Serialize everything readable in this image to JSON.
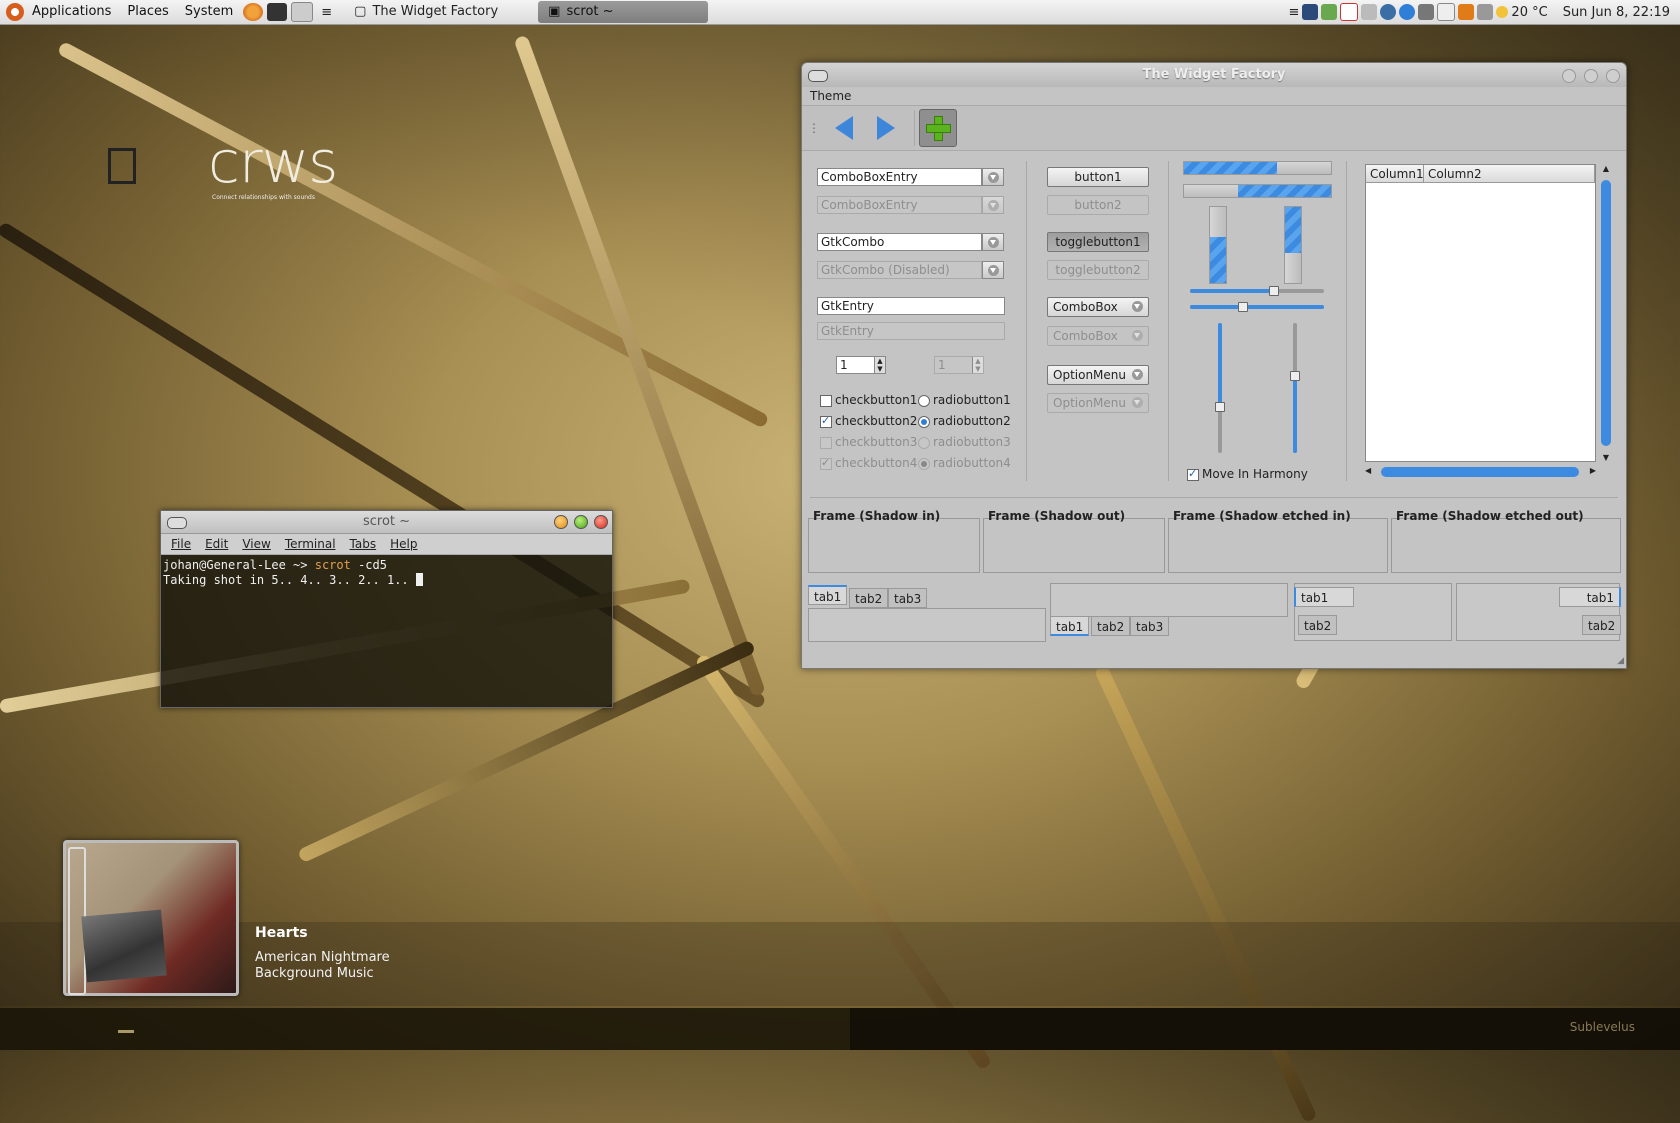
{
  "top_panel": {
    "menus": [
      "Applications",
      "Places",
      "System"
    ],
    "tasks": [
      {
        "label": "The Widget Factory"
      },
      {
        "label": "scrot  ~"
      }
    ],
    "weather": "20 °C",
    "clock": "Sun Jun  8, 22:19"
  },
  "desktop": {
    "logo_text": "crws",
    "logo_tagline": "Connect relationships with sounds"
  },
  "widget_factory": {
    "title": "The Widget Factory",
    "menu_label": "Theme",
    "entries": {
      "combo_entry_1": "ComboBoxEntry",
      "combo_entry_2": "ComboBoxEntry",
      "gtk_combo": "GtkCombo",
      "gtk_combo_disabled": "GtkCombo (Disabled)",
      "gtk_entry": "GtkEntry",
      "gtk_entry_disabled": "GtkEntry"
    },
    "spin_values": [
      "1",
      "1"
    ],
    "checks": [
      "checkbutton1",
      "checkbutton2",
      "checkbutton3",
      "checkbutton4"
    ],
    "radios": [
      "radiobutton1",
      "radiobutton2",
      "radiobutton3",
      "radiobutton4"
    ],
    "buttons": {
      "button1": "button1",
      "button2": "button2",
      "toggle1": "togglebutton1",
      "toggle2": "togglebutton2",
      "combobox1": "ComboBox",
      "combobox2": "ComboBox",
      "optionmenu1": "OptionMenu",
      "optionmenu2": "OptionMenu"
    },
    "progress": {
      "h1": 0.63,
      "h2": 0.63,
      "v1": 0.6,
      "v2": 0.6
    },
    "sliders": {
      "h1": 0.6,
      "h2": 0.36,
      "v1": 0.62,
      "v2": 0.38
    },
    "move_in_harmony": "Move In Harmony",
    "columns": [
      "Column1",
      "Column2"
    ],
    "frames": [
      "Frame (Shadow in)",
      "Frame (Shadow out)",
      "Frame (Shadow etched in)",
      "Frame (Shadow etched out)"
    ],
    "tabs": [
      "tab1",
      "tab2",
      "tab3"
    ]
  },
  "terminal": {
    "title": "scrot  ~",
    "menus": [
      "File",
      "Edit",
      "View",
      "Terminal",
      "Tabs",
      "Help"
    ],
    "prompt": "johan@General-Lee ~> ",
    "command": "scrot",
    "args": " -cd5",
    "output": "Taking shot in 5.. 4.. 3.. 2.. 1.. "
  },
  "music": {
    "song": "Hearts",
    "artist": "American Nightmare",
    "album": "Background Music"
  },
  "bottom_panel": {
    "label": "Sublevelus"
  },
  "colors": {
    "accent": "#3d8be0",
    "panel_bg": "#dcdcdc"
  }
}
